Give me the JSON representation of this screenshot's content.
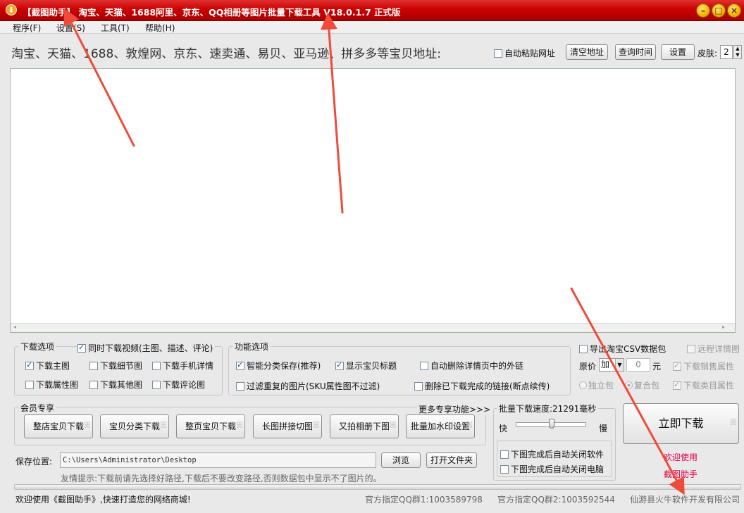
{
  "window": {
    "title": "【截图助手】 淘宝、天猫、1688阿里、京东、QQ相册等图片批量下载工具 V18.0.1.7 正式版",
    "minimize": "–",
    "maximize": "□",
    "close": "×"
  },
  "menu": [
    {
      "label": "程序(F)"
    },
    {
      "label": "设置(S)"
    },
    {
      "label": "工具(T)"
    },
    {
      "label": "帮助(H)"
    }
  ],
  "address": {
    "label": "淘宝、天猫、1688、敦煌网、京东、速卖通、易贝、亚马逊、拼多多等宝贝地址:",
    "auto_paste_label": "自动粘贴网址",
    "clear_button": "清空地址",
    "query_time_button": "查询时间",
    "settings_button": "设置",
    "skin_label": "皮肤:",
    "skin_value": "2"
  },
  "scrollbar": {
    "left": "◂",
    "right": "▸"
  },
  "download_options": {
    "title": "下载选项",
    "video_label": "同时下载视频(主图、描述、评论)",
    "items": [
      {
        "label": "下载主图",
        "checked": true
      },
      {
        "label": "下载细节图",
        "checked": false
      },
      {
        "label": "下载手机详情",
        "checked": false
      },
      {
        "label": "下载属性图",
        "checked": false
      },
      {
        "label": "下载其他图",
        "checked": false
      },
      {
        "label": "下载评论图",
        "checked": false
      }
    ]
  },
  "function_options": {
    "title": "功能选项",
    "items": [
      {
        "label": "智能分类保存(推荐)",
        "checked": true
      },
      {
        "label": "显示宝贝标题",
        "checked": true
      },
      {
        "label": "自动删除详情页中的外链",
        "checked": false
      },
      {
        "label": "过滤重复的图片(SKU属性图不过滤)",
        "checked": false
      },
      {
        "label": "删除已下载完成的链接(断点续传)",
        "checked": false
      }
    ]
  },
  "csv": {
    "export_label": "导出淘宝CSV数据包",
    "remote_detail_label": "远程详情图",
    "price_label": "原价",
    "price_op": "加",
    "price_value": "0",
    "unit": "元",
    "sales_attr_label": "下载销售属性",
    "standalone_label": "独立包",
    "composite_label": "复合包",
    "category_attr_label": "下载类目属性"
  },
  "member": {
    "title": "会员专享",
    "more": "更多专享功能>>>",
    "buttons": [
      "整店宝贝下载",
      "宝贝分类下载",
      "整页宝贝下载",
      "长图拼接切图",
      "又拍相册下图",
      "批量加水印设置"
    ]
  },
  "save": {
    "label": "保存位置:",
    "path": "C:\\Users\\Administrator\\Desktop",
    "browse": "浏览",
    "open_folder": "打开文件夹",
    "tip": "友情提示:下载前请先选择好路径,下载后不要改变路径,否则数据包中显示不了图片的。"
  },
  "speed": {
    "title": "批量下载速度:21291毫秒",
    "fast": "快",
    "slow": "慢",
    "level": 0.5,
    "close_app_label": "下图完成后自动关闭软件",
    "shutdown_label": "下图完成后自动关闭电脑"
  },
  "download_now": "立即下载",
  "welcome": {
    "line1": "欢迎使用",
    "line2": "截图助手"
  },
  "status": {
    "welcome": "欢迎使用《截图助手》,快速打造您的网络商城!",
    "qq1": "官方指定QQ群1:1003589798",
    "qq2": "官方指定QQ群2:1003592544",
    "company": "仙游县火牛软件开发有限公司"
  },
  "colors": {
    "title_bar": "#cc0000",
    "annotation_arrow": "#f04a3a",
    "link_red": "#e8004a"
  }
}
